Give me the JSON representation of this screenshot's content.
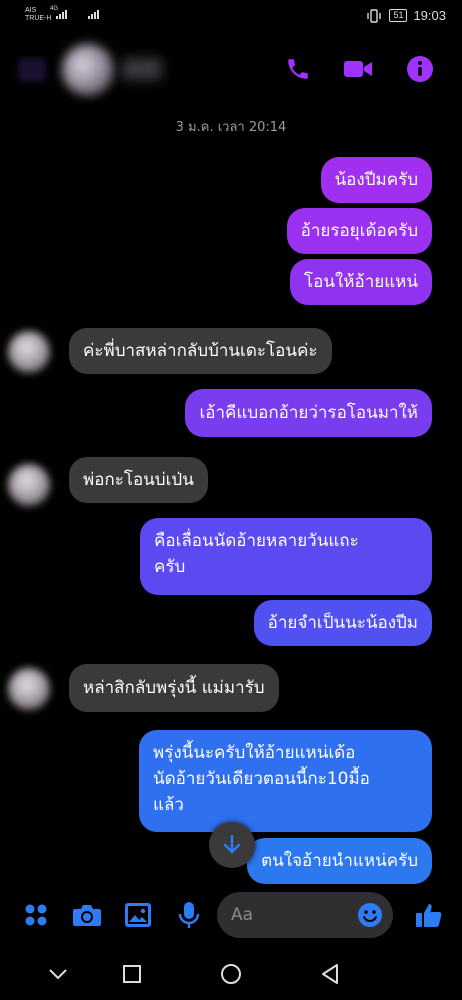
{
  "status_bar": {
    "carrier_line1": "AIS",
    "carrier_line2": "TRUE-H",
    "network": "4G",
    "battery": "51",
    "time": "19:03"
  },
  "header": {
    "call_icon": "phone-icon",
    "video_icon": "video-camera-icon",
    "info_icon": "info-icon",
    "accent_color": "#a033ff"
  },
  "timestamp": "3 ม.ค. เวลา 20:14",
  "messages": [
    {
      "from": "me",
      "text": "น้องปีมครับ",
      "color": "#a12ff0"
    },
    {
      "from": "me",
      "text": "อ้ายรอยุเด้อครับ",
      "color": "#9a30f0"
    },
    {
      "from": "me",
      "text": "โอนให้อ้ายแหน่",
      "color": "#8f33f0"
    },
    {
      "from": "them",
      "text": "ค่ะพี่บาสหล่ากลับบ้านเดะโอนค่ะ"
    },
    {
      "from": "me",
      "text": "เอ้าคีแบอกอ้ายว่ารอโอนมาให้",
      "color": "#7a3cef"
    },
    {
      "from": "them",
      "text": "พ่อกะโอนบ่เป่น"
    },
    {
      "from": "me",
      "text": "คือเลื่อนนัดอ้ายหลายวันแถะครับ",
      "lines": [
        "คือเลื่อนนัดอ้ายหลายวันแถะ",
        "ครับ"
      ],
      "color": "#5b4af0"
    },
    {
      "from": "me",
      "text": "อ้ายจำเป็นนะน้องปีม",
      "color": "#5150f0"
    },
    {
      "from": "them",
      "text": "หล่าสิกลับพรุ่งนี้ แม่มารับ"
    },
    {
      "from": "me",
      "text": "พรุ่งนี้นะครับให้อ้ายแหน่เด้อนัดอ้ายวันเดียวตอนนี้กะ10มื้อแล้ว",
      "lines": [
        "พรุ่งนี้นะครับให้อ้ายแหน่เด้อ",
        "นัดอ้ายวันเดียวตอนนี้กะ10มื้อ",
        "แล้ว"
      ],
      "color": "#2f70f0"
    },
    {
      "from": "me",
      "text": "ตนใจอ้ายนำแหน่ครับ",
      "color": "#2b78ef"
    }
  ],
  "composer": {
    "placeholder": "Aa",
    "icons": [
      "apps-icon",
      "camera-icon",
      "gallery-icon",
      "microphone-icon",
      "emoji-icon",
      "like-icon"
    ],
    "icon_color": "#2d7cf6"
  },
  "scroll_button_icon": "arrow-down-icon",
  "nav": [
    "back-nav-icon",
    "home-nav-icon",
    "recents-nav-icon",
    "down-nav-icon"
  ]
}
